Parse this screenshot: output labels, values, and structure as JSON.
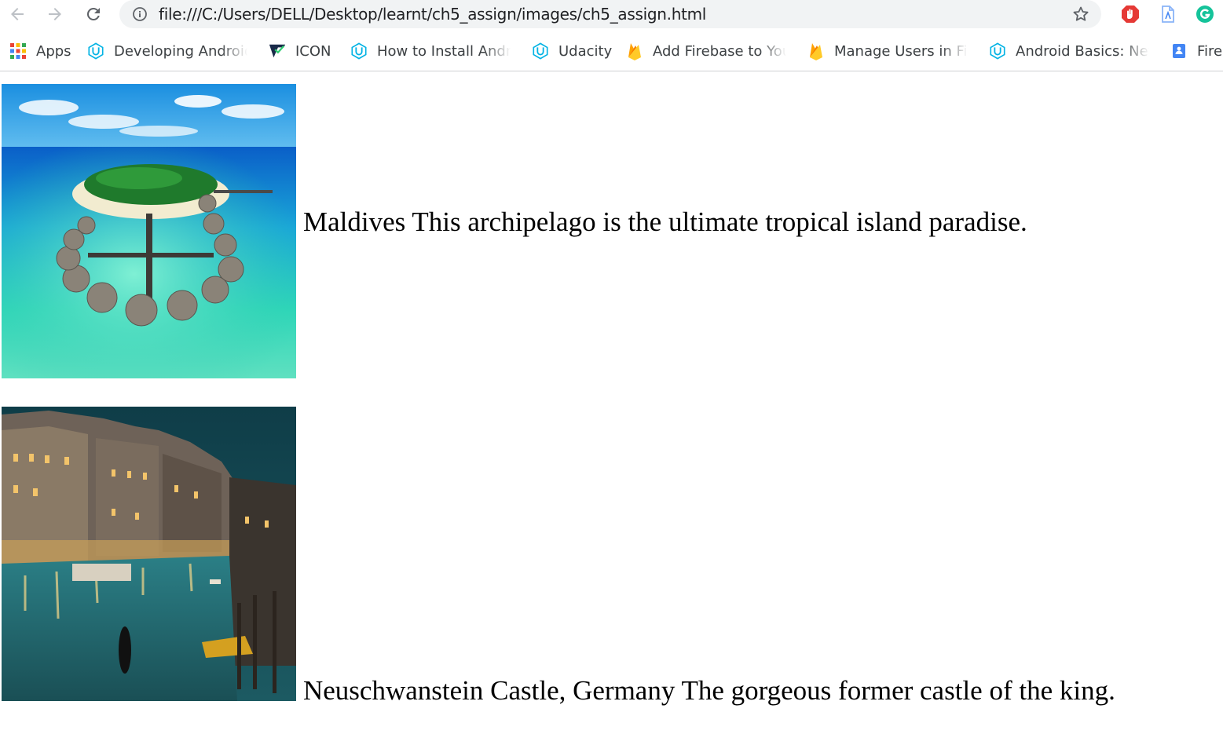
{
  "browser": {
    "url": "file:///C:/Users/DELL/Desktop/learnt/ch5_assign/images/ch5_assign.html"
  },
  "bookmarks": [
    {
      "label": "Apps",
      "icon": "apps-grid-icon"
    },
    {
      "label": "Developing Android /",
      "icon": "udacity-icon"
    },
    {
      "label": "ICON",
      "icon": "icon-logo-icon"
    },
    {
      "label": "How to Install Androi",
      "icon": "udacity-icon"
    },
    {
      "label": "Udacity",
      "icon": "udacity-icon"
    },
    {
      "label": "Add Firebase to Your",
      "icon": "firebase-icon"
    },
    {
      "label": "Manage Users in Fire",
      "icon": "firebase-icon"
    },
    {
      "label": "Android Basics: Netw",
      "icon": "udacity-icon"
    },
    {
      "label": "Firel",
      "icon": "google-docs-icon"
    }
  ],
  "page": {
    "items": [
      {
        "caption": "Maldives This archipelago is the ultimate tropical island paradise.",
        "image": "maldives-photo"
      },
      {
        "caption": "Neuschwanstein Castle, Germany The gorgeous former castle of the king.",
        "image": "venice-canal-photo"
      }
    ]
  },
  "colors": {
    "accent_blue": "#02b3e4",
    "firebase_orange": "#ffa000",
    "firebase_yellow": "#ffca28"
  }
}
